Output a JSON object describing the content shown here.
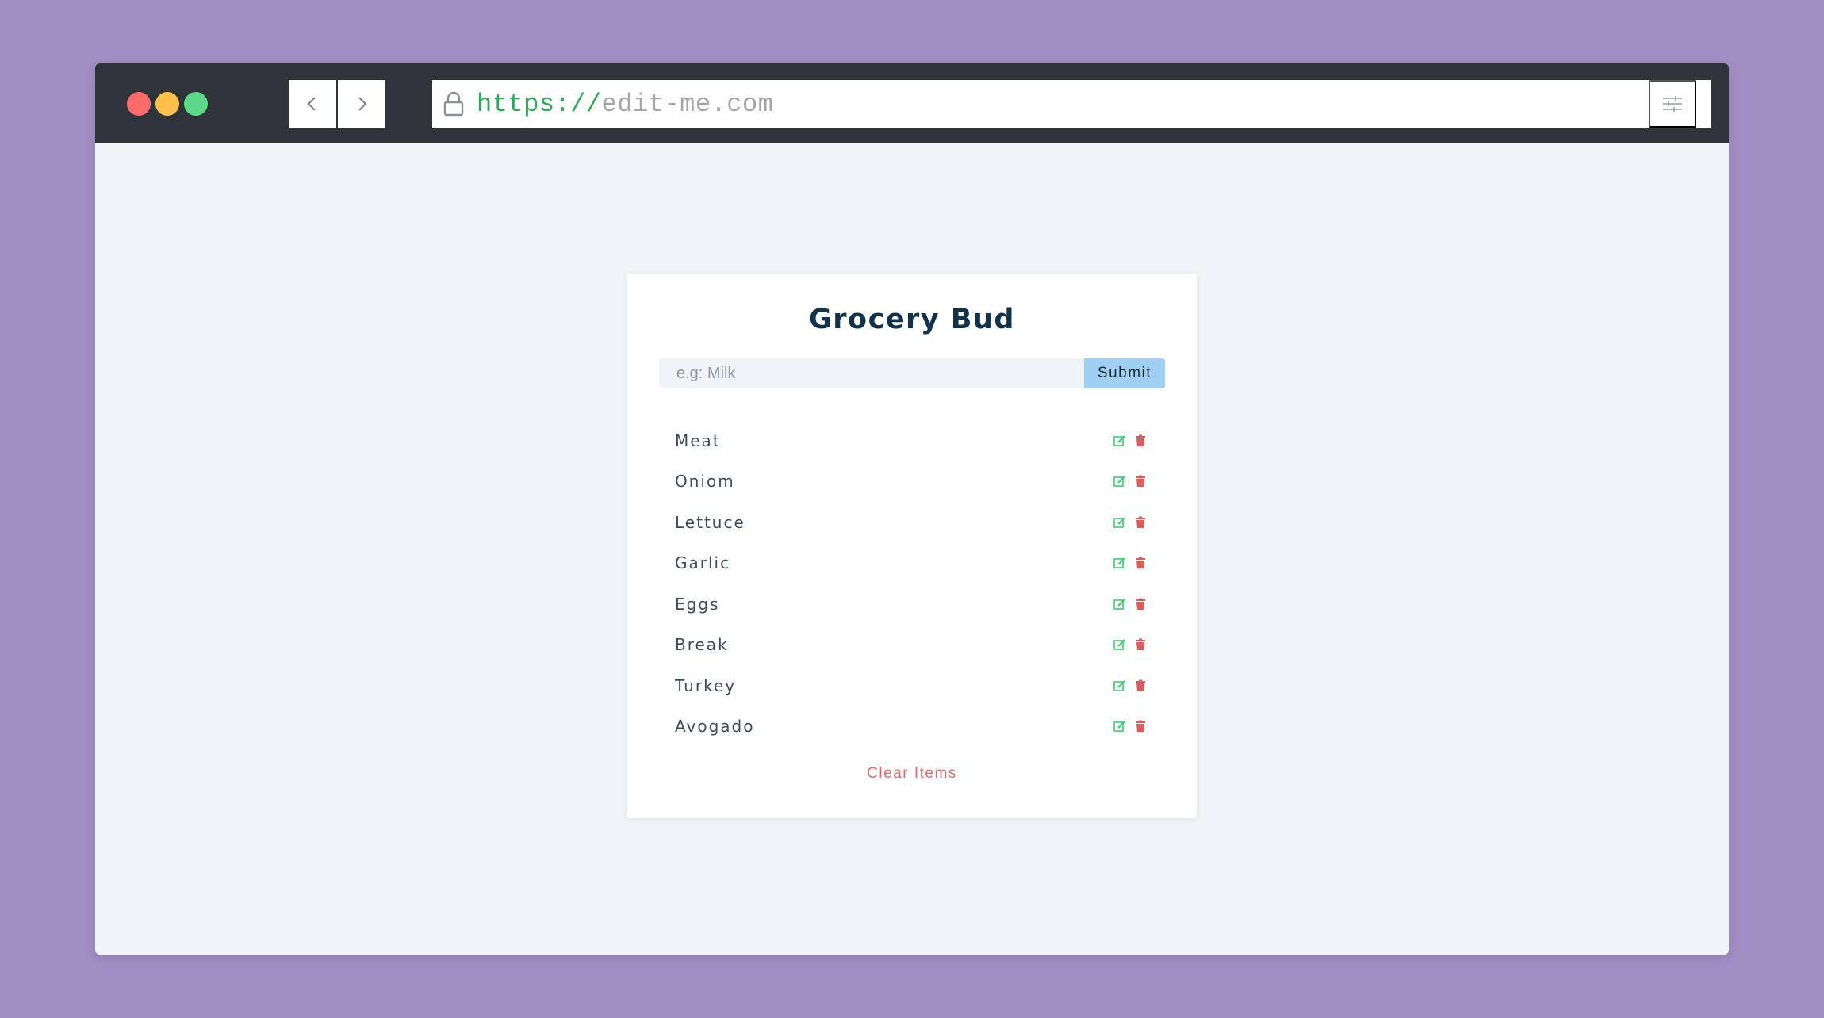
{
  "browser": {
    "url_scheme": "https://",
    "url_host": "edit-me.com",
    "icons": {
      "back": "chevron-left-icon",
      "forward": "chevron-right-icon",
      "lock": "lock-icon",
      "menu": "sliders-icon"
    },
    "colors": {
      "close": "#ff6b6b",
      "minimize": "#fdc14b",
      "maximize": "#5cd88a",
      "toolbar": "#2e3439"
    }
  },
  "app": {
    "title": "Grocery Bud",
    "input_placeholder": "e.g: Milk",
    "input_value": "",
    "submit_label": "Submit",
    "items": [
      {
        "name": "Meat"
      },
      {
        "name": "Oniom"
      },
      {
        "name": "Lettuce"
      },
      {
        "name": "Garlic"
      },
      {
        "name": "Eggs"
      },
      {
        "name": "Break"
      },
      {
        "name": "Turkey"
      },
      {
        "name": "Avogado"
      }
    ],
    "item_icons": {
      "edit": "edit-icon",
      "delete": "trash-icon"
    },
    "clear_label": "Clear Items",
    "colors": {
      "edit": "#3ecf6e",
      "delete": "#e05a5a",
      "clear": "#e46a6a",
      "submit_bg": "#9fd0f3",
      "title": "#10324a"
    }
  }
}
